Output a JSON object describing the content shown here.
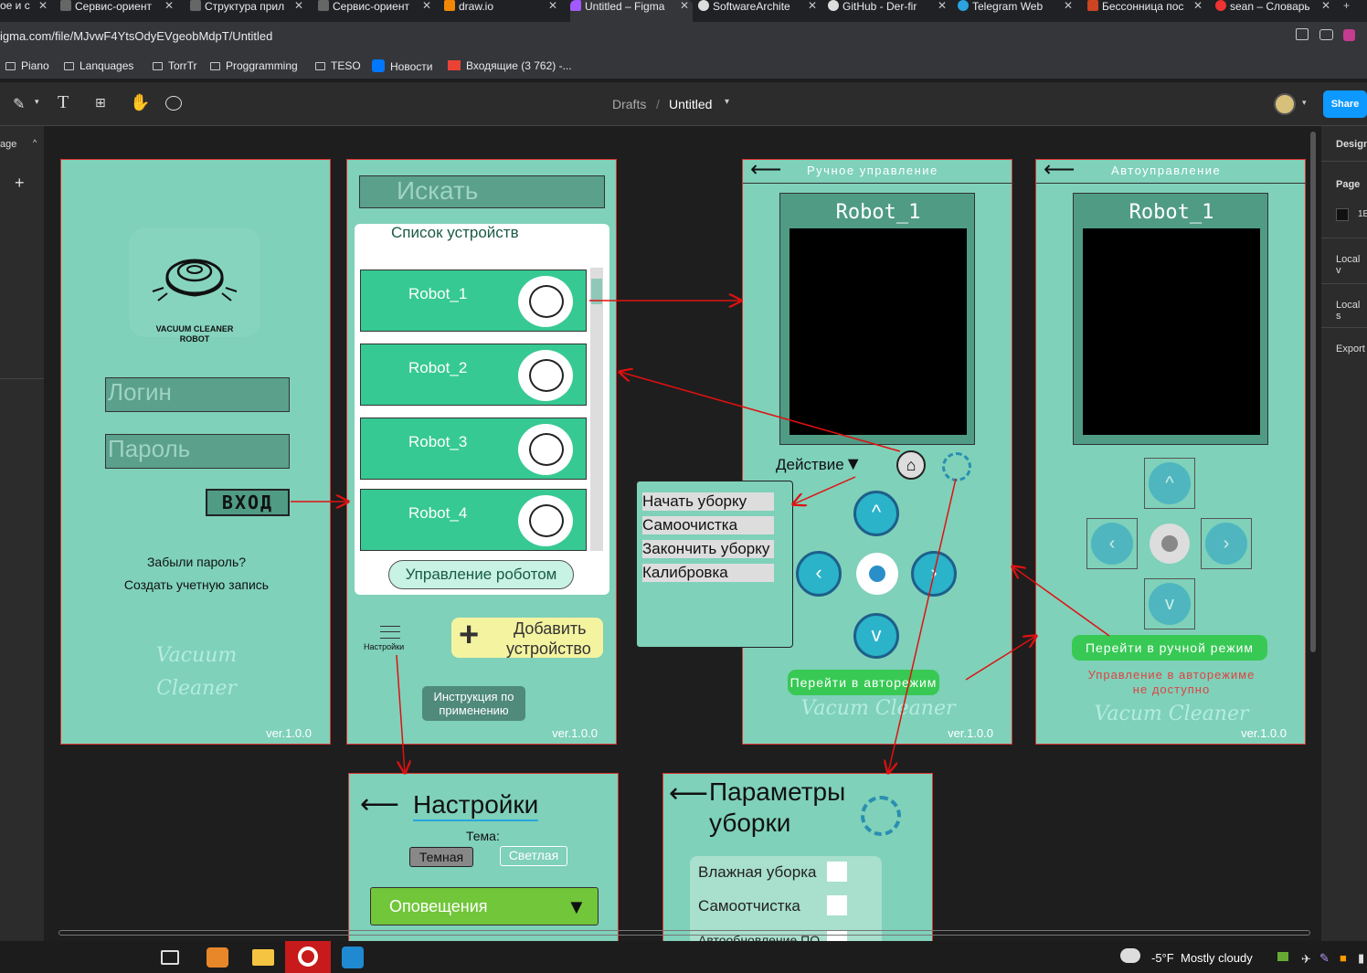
{
  "browser": {
    "tabs": [
      {
        "label": "ое и с",
        "active": false
      },
      {
        "label": "Сервис-ориент",
        "active": false
      },
      {
        "label": "Структура прил",
        "active": false
      },
      {
        "label": "Сервис-ориент",
        "active": false
      },
      {
        "label": "draw.io",
        "active": false
      },
      {
        "label": "Untitled – Figma",
        "active": true
      },
      {
        "label": "SoftwareArchite",
        "active": false
      },
      {
        "label": "GitHub - Der-fir",
        "active": false
      },
      {
        "label": "Telegram Web",
        "active": false
      },
      {
        "label": "Бессонница пос",
        "active": false
      },
      {
        "label": "sean – Словарь",
        "active": false
      }
    ],
    "url": "igma.com/file/MJvwF4YtsOdyEVgeobMdpT/Untitled",
    "bookmarks": [
      "Piano",
      "Lanquages",
      "TorrTr",
      "Proggramming",
      "TESO",
      "Новости",
      "Входящие (3 762) -..."
    ]
  },
  "figma": {
    "breadcrumb_parent": "Drafts",
    "breadcrumb_sep": "/",
    "file_name": "Untitled",
    "share": "Share",
    "left_page": "age",
    "right_panel": [
      "Design",
      "Page",
      "1E",
      "Local v",
      "Local s",
      "Export"
    ]
  },
  "login": {
    "logo_line1": "VACUUM CLEANER",
    "logo_line2": "ROBOT",
    "login_placeholder": "Логин",
    "password_placeholder": "Пароль",
    "enter": "ВХОД",
    "forgot": "Забыли пароль?",
    "create": "Создать учетную запись",
    "script1": "Vacuum",
    "script2": "Cleaner",
    "version": "ver.1.0.0"
  },
  "devices": {
    "search": "Искать",
    "list_title": "Список устройств",
    "robots": [
      "Robot_1",
      "Robot_2",
      "Robot_3",
      "Robot_4"
    ],
    "manage": "Управление роботом",
    "settings": "Настройки",
    "add_line1": "Добавить",
    "add_line2": "устройство",
    "instr_line1": "Инструкция по",
    "instr_line2": "применению",
    "version": "ver.1.0.0"
  },
  "manual": {
    "title": "Ручное управление",
    "robot": "Robot_1",
    "action": "Действие",
    "auto_btn": "Перейти в авторежим",
    "script": "Vacum Cleaner",
    "version": "ver.1.0.0"
  },
  "action_menu": [
    "Начать уборку",
    "Самоочистка",
    "Закончить уборку",
    "Калибровка"
  ],
  "auto": {
    "title": "Автоуправление",
    "robot": "Robot_1",
    "manual_btn": "Перейти в ручной режим",
    "warning1": "Управление в авторежиме",
    "warning2": "не доступно",
    "script": "Vacum Cleaner",
    "version": "ver.1.0.0"
  },
  "settings_frame": {
    "title": "Настройки",
    "theme": "Тема:",
    "dark": "Темная",
    "light": "Светлая",
    "notifications": "Оповещения"
  },
  "clean_params": {
    "title1": "Параметры",
    "title2": "уборки",
    "options": [
      "Влажная уборка",
      "Самоотчистка",
      "Автообновление ПО"
    ]
  },
  "taskbar": {
    "temp": "-5°F",
    "weather": "Mostly cloudy"
  },
  "colors": {
    "frame_bg": "#7fd1b9",
    "dark_teal": "#5aa08b",
    "green_btn": "#37c993",
    "figma_blue": "#0d99ff",
    "arrow_red": "#e01010"
  }
}
